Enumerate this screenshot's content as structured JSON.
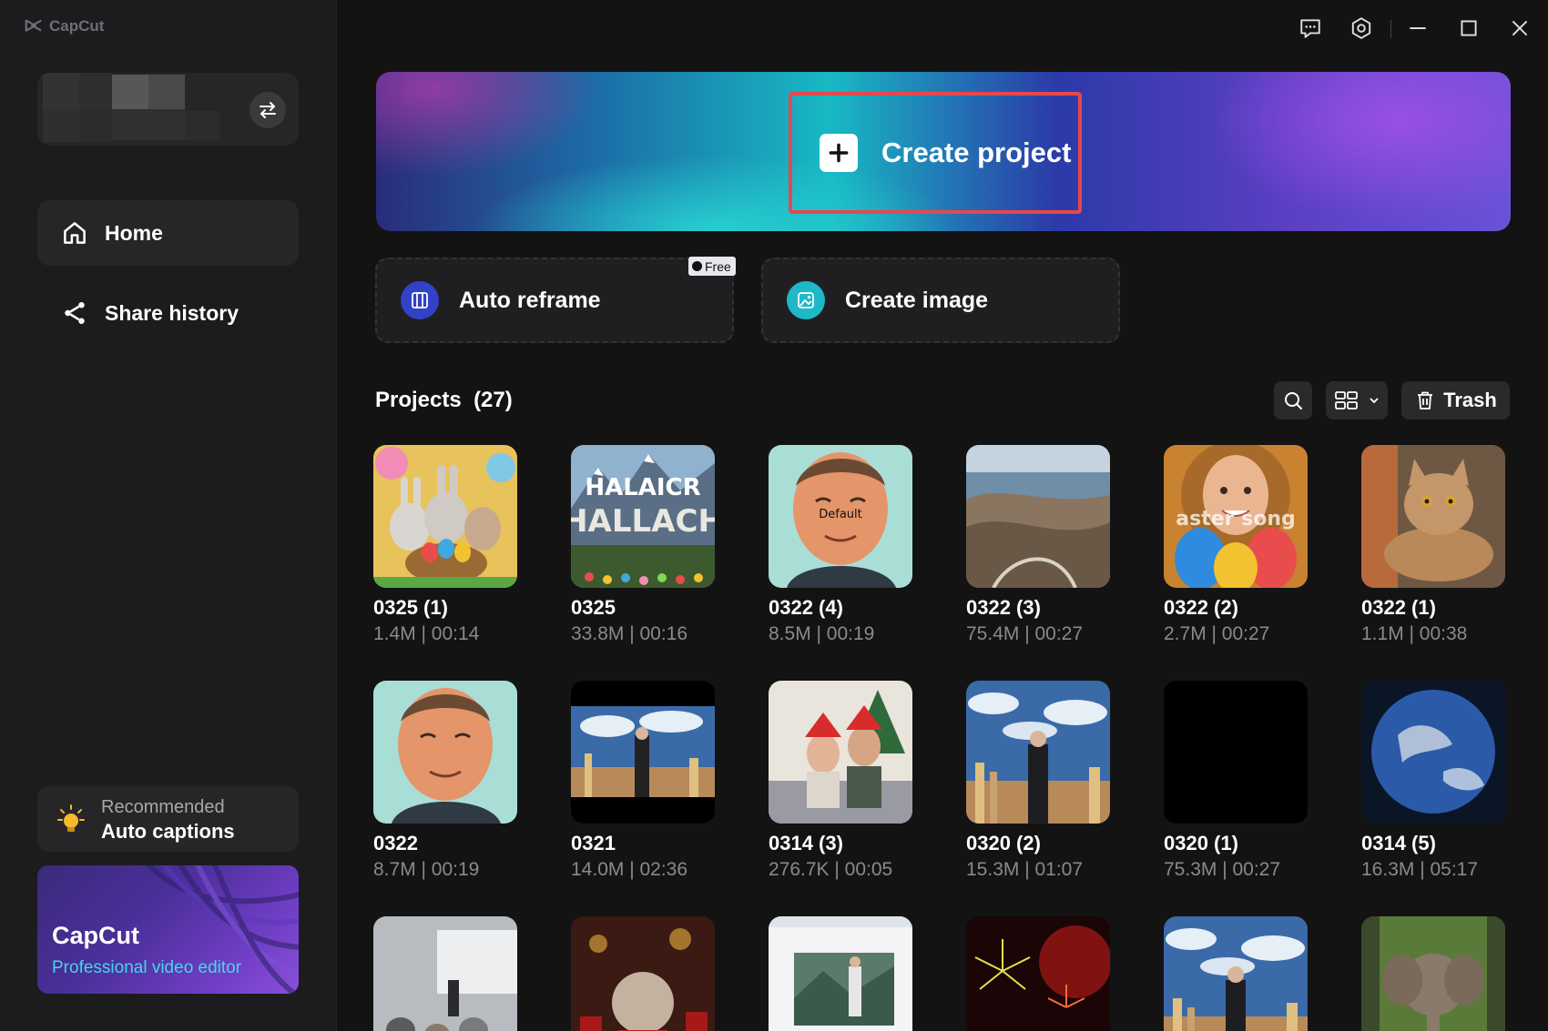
{
  "app": {
    "brand": "CapCut"
  },
  "sidebar": {
    "nav": [
      {
        "label": "Home",
        "icon": "home-icon",
        "active": true
      },
      {
        "label": "Share history",
        "icon": "share-icon",
        "active": false
      }
    ],
    "recommended": {
      "caption": "Recommended",
      "title": "Auto captions"
    },
    "promo": {
      "title": "CapCut",
      "subtitle": "Professional video editor"
    }
  },
  "banner": {
    "create_label": "Create project"
  },
  "quick_actions": [
    {
      "label": "Auto reframe",
      "icon": "reframe-icon",
      "badge": "Free"
    },
    {
      "label": "Create image",
      "icon": "image-icon"
    }
  ],
  "projects": {
    "title": "Projects",
    "count": "(27)",
    "trash_label": "Trash",
    "items": [
      {
        "name": "0325 (1)",
        "meta": "1.4M | 00:14",
        "thumb": "easter-bunnies"
      },
      {
        "name": "0325",
        "meta": "33.8M | 00:16",
        "thumb": "mountain-title"
      },
      {
        "name": "0322 (4)",
        "meta": "8.5M | 00:19",
        "thumb": "cartoon-man",
        "overlay": "Default"
      },
      {
        "name": "0322 (3)",
        "meta": "75.4M | 00:27",
        "thumb": "coast-aerial"
      },
      {
        "name": "0322 (2)",
        "meta": "2.7M | 00:27",
        "thumb": "girl-eggs",
        "overlay": "aster song"
      },
      {
        "name": "0322 (1)",
        "meta": "1.1M | 00:38",
        "thumb": "cat"
      },
      {
        "name": "0322",
        "meta": "8.7M | 00:19",
        "thumb": "cartoon-man"
      },
      {
        "name": "0321",
        "meta": "14.0M | 02:36",
        "thumb": "woman-city-wide"
      },
      {
        "name": "0314 (3)",
        "meta": "276.7K | 00:05",
        "thumb": "christmas-couple"
      },
      {
        "name": "0320 (2)",
        "meta": "15.3M | 01:07",
        "thumb": "woman-city"
      },
      {
        "name": "0320 (1)",
        "meta": "75.3M | 00:27",
        "thumb": "black"
      },
      {
        "name": "0314 (5)",
        "meta": "16.3M | 05:17",
        "thumb": "earth"
      },
      {
        "name": "",
        "meta": "",
        "thumb": "presentation"
      },
      {
        "name": "",
        "meta": "",
        "thumb": "snow-globe"
      },
      {
        "name": "",
        "meta": "",
        "thumb": "screen-capture"
      },
      {
        "name": "",
        "meta": "",
        "thumb": "fireworks"
      },
      {
        "name": "",
        "meta": "",
        "thumb": "woman-city"
      },
      {
        "name": "",
        "meta": "",
        "thumb": "elephant"
      }
    ]
  },
  "colors": {
    "accent_red": "#e5484d",
    "cyan": "#46d6e8",
    "sidebar_bg": "#1c1c1e",
    "bg": "#131313"
  }
}
